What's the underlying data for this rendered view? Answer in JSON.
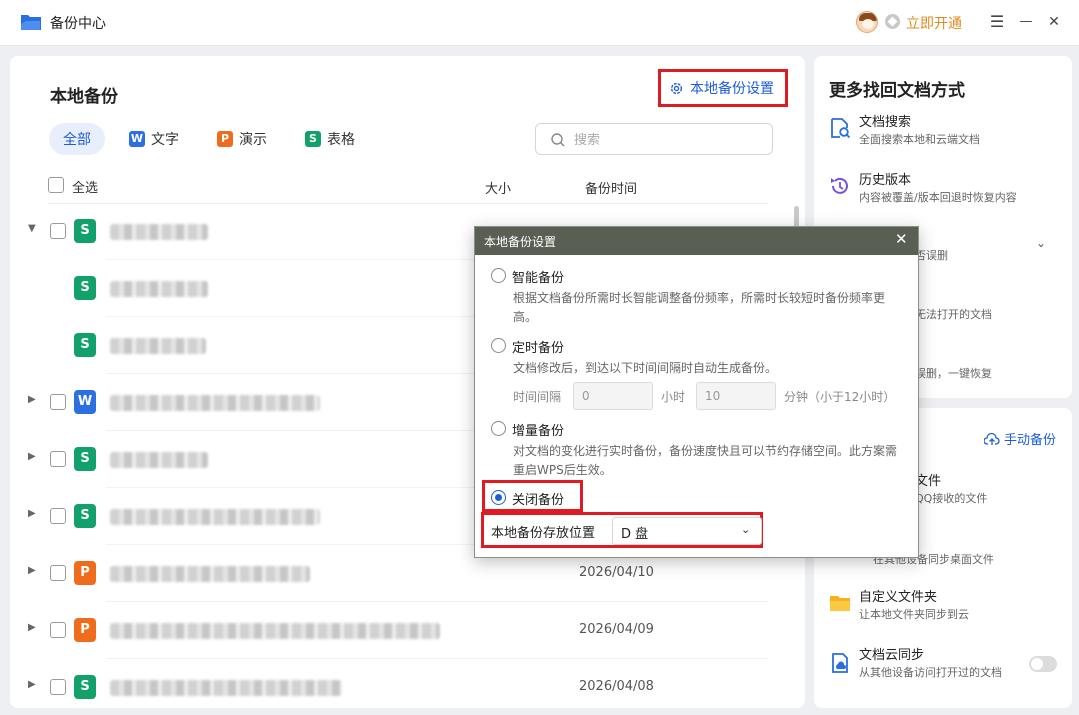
{
  "window": {
    "title": "备份中心",
    "vip_label": "立即开通",
    "menu_glyph": "☰",
    "min_glyph": "—",
    "close_glyph": "✕"
  },
  "main": {
    "title": "本地备份",
    "settings_label": "本地备份设置",
    "tabs": [
      {
        "label": "全部",
        "badge": ""
      },
      {
        "label": "文字",
        "badge": "W"
      },
      {
        "label": "演示",
        "badge": "P"
      },
      {
        "label": "表格",
        "badge": "S"
      }
    ],
    "search_placeholder": "搜索",
    "header": {
      "select_all": "全选",
      "size": "大小",
      "time": "备份时间"
    },
    "rows": [
      {
        "type": "S",
        "date": ""
      },
      {
        "type": "S",
        "date": ""
      },
      {
        "type": "S",
        "date": ""
      },
      {
        "type": "W",
        "date": ""
      },
      {
        "type": "S",
        "date": ""
      },
      {
        "type": "S",
        "date": ""
      },
      {
        "type": "P",
        "date": "2026/04/10"
      },
      {
        "type": "P",
        "date": "2026/04/09"
      },
      {
        "type": "S",
        "date": "2026/04/08"
      }
    ]
  },
  "side": {
    "title": "更多找回文档方式",
    "items": [
      {
        "title": "文档搜索",
        "desc": "全面搜索本地和云端文档",
        "icon": "doc-search-icon"
      },
      {
        "title": "历史版本",
        "desc": "内容被覆盖/版本回退时恢复内容",
        "icon": "history-icon"
      },
      {
        "title": "",
        "desc": "否误删",
        "icon": ""
      },
      {
        "title": "",
        "desc": "无法打开的文档",
        "icon": ""
      },
      {
        "title": "",
        "desc": "误删，一键恢复",
        "icon": ""
      }
    ],
    "manual_backup": "手动备份",
    "cloud_items": [
      {
        "title": "文件",
        "desc": "QQ接收的文件"
      },
      {
        "title": "",
        "desc": "在其他设备同步桌面文件"
      },
      {
        "title": "自定义文件夹",
        "desc": "让本地文件夹同步到云"
      },
      {
        "title": "文档云同步",
        "desc": "从其他设备访问打开过的文档"
      }
    ]
  },
  "dialog": {
    "title": "本地备份设置",
    "options": [
      {
        "label": "智能备份",
        "desc": "根据文档备份所需时长智能调整备份频率，所需时长较短时备份频率更高。",
        "checked": false
      },
      {
        "label": "定时备份",
        "desc": "文档修改后，到达以下时间间隔时自动生成备份。",
        "checked": false
      },
      {
        "label": "增量备份",
        "desc": "对文档的变化进行实时备份，备份速度快且可以节约存储空间。此方案需重启WPS后生效。",
        "checked": false
      },
      {
        "label": "关闭备份",
        "desc": "",
        "checked": true
      }
    ],
    "interval": {
      "label": "时间间隔",
      "hours_value": "0",
      "hours_unit": "小时",
      "minutes_value": "10",
      "minutes_unit": "分钟（小于12小时）"
    },
    "location": {
      "label": "本地备份存放位置",
      "value": "D 盘"
    }
  },
  "colors": {
    "accent": "#1d5fd1",
    "highlight": "#e01a22",
    "vip": "#e08a1e",
    "dialog_header": "#5a5f54"
  }
}
